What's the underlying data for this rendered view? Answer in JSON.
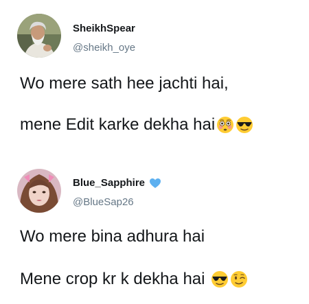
{
  "tweets": [
    {
      "display_name": "SheikhSpear",
      "handle": "@sheikh_oye",
      "lines": [
        "Wo mere sath hee jachti hai,",
        "mene Edit karke dekha hai"
      ],
      "emojis": [
        "flushed-face",
        "sunglasses-face"
      ]
    },
    {
      "display_name": "Blue_Sapphire",
      "handle": "@BlueSap26",
      "name_badge": "blue-heart",
      "lines": [
        "Wo mere bina adhura hai",
        "Mene crop kr k dekha hai "
      ],
      "emojis": [
        "sunglasses-face",
        "winking-face"
      ]
    }
  ],
  "colors": {
    "text": "#14171a",
    "handle": "#657786",
    "heart": "#5db0f0",
    "emoji_yellow": "#ffcc33"
  }
}
